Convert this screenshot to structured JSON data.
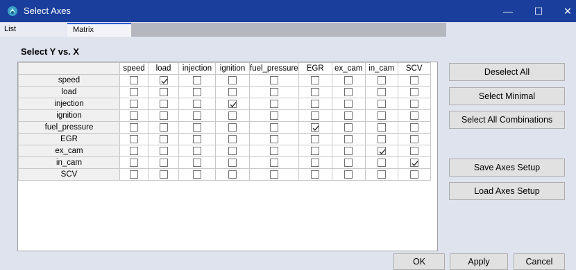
{
  "window": {
    "title": "Select Axes",
    "controls": {
      "minimize": "—",
      "maximize": "☐",
      "close": "✕"
    }
  },
  "tabs": [
    {
      "label": "List",
      "selected": false
    },
    {
      "label": "Matrix",
      "selected": true
    }
  ],
  "section_title": "Select Y vs. X",
  "matrix": {
    "columns": [
      "speed",
      "load",
      "injection",
      "ignition",
      "fuel_pressure",
      "EGR",
      "ex_cam",
      "in_cam",
      "SCV"
    ],
    "rows": [
      {
        "label": "speed",
        "checked": [
          false,
          true,
          false,
          false,
          false,
          false,
          false,
          false,
          false
        ]
      },
      {
        "label": "load",
        "checked": [
          false,
          false,
          false,
          false,
          false,
          false,
          false,
          false,
          false
        ]
      },
      {
        "label": "injection",
        "checked": [
          false,
          false,
          false,
          true,
          false,
          false,
          false,
          false,
          false
        ]
      },
      {
        "label": "ignition",
        "checked": [
          false,
          false,
          false,
          false,
          false,
          false,
          false,
          false,
          false
        ]
      },
      {
        "label": "fuel_pressure",
        "checked": [
          false,
          false,
          false,
          false,
          false,
          true,
          false,
          false,
          false
        ]
      },
      {
        "label": "EGR",
        "checked": [
          false,
          false,
          false,
          false,
          false,
          false,
          false,
          false,
          false
        ]
      },
      {
        "label": "ex_cam",
        "checked": [
          false,
          false,
          false,
          false,
          false,
          false,
          false,
          true,
          false
        ]
      },
      {
        "label": "in_cam",
        "checked": [
          false,
          false,
          false,
          false,
          false,
          false,
          false,
          false,
          true
        ]
      },
      {
        "label": "SCV",
        "checked": [
          false,
          false,
          false,
          false,
          false,
          false,
          false,
          false,
          false
        ]
      }
    ]
  },
  "side_buttons": {
    "deselect_all": "Deselect All",
    "select_minimal": "Select Minimal",
    "select_all": "Select All Combinations",
    "save": "Save Axes Setup",
    "load": "Load Axes Setup"
  },
  "bottom_buttons": {
    "ok": "OK",
    "apply": "Apply",
    "cancel": "Cancel"
  },
  "colors": {
    "titlebar": "#1a3e9c",
    "background": "#dfe3ee",
    "tab_accent": "#2a5bd7"
  }
}
